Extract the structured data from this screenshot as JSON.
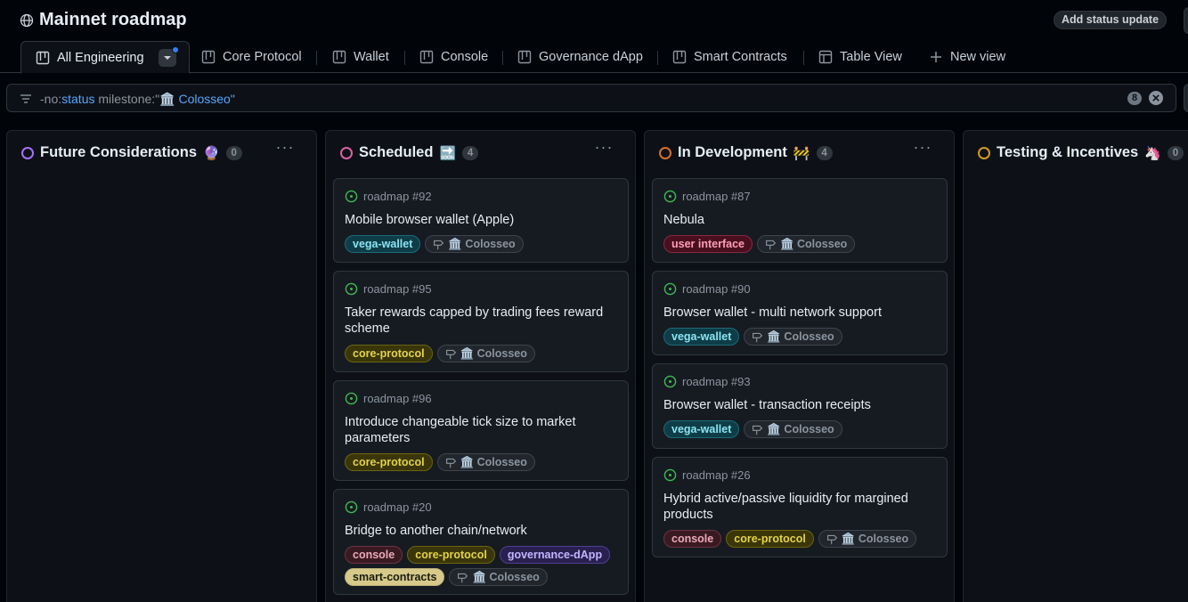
{
  "project": {
    "title": "Mainnet roadmap",
    "status_button": "Add status update"
  },
  "tabs": [
    {
      "label": "All Engineering",
      "icon": "board-icon"
    },
    {
      "label": "Core Protocol",
      "icon": "board-icon"
    },
    {
      "label": "Wallet",
      "icon": "board-icon"
    },
    {
      "label": "Console",
      "icon": "board-icon"
    },
    {
      "label": "Governance dApp",
      "icon": "board-icon"
    },
    {
      "label": "Smart Contracts",
      "icon": "board-icon"
    },
    {
      "label": "Table View",
      "icon": "table-icon"
    },
    {
      "label": "New view",
      "icon": "plus-icon"
    }
  ],
  "filter": {
    "prefix": "-no:",
    "status_kw": "status",
    "milestone_kw": " milestone:\"",
    "milestone_value": "🏛️ Colosseo\"",
    "count": "8"
  },
  "columns": [
    {
      "name": "Future Considerations",
      "emoji": "🔮",
      "count": "0",
      "ring_color": "#a371f7"
    },
    {
      "name": "Scheduled",
      "emoji": "🔜",
      "count": "4",
      "ring_color": "#db61a2"
    },
    {
      "name": "In Development",
      "emoji": "🚧",
      "count": "4",
      "ring_color": "#db6d28"
    },
    {
      "name": "Testing & Incentives",
      "emoji": "🦄",
      "count": "0",
      "ring_color": "#d29922"
    }
  ],
  "milestone_label": "🏛️ Colosseo",
  "cards": {
    "scheduled": [
      {
        "ref": "roadmap #92",
        "title": "Mobile browser wallet (Apple)",
        "labels": [
          "vega-wallet"
        ]
      },
      {
        "ref": "roadmap #95",
        "title": "Taker rewards capped by trading fees reward scheme",
        "labels": [
          "core-protocol"
        ]
      },
      {
        "ref": "roadmap #96",
        "title": "Introduce changeable tick size to market parameters",
        "labels": [
          "core-protocol"
        ]
      },
      {
        "ref": "roadmap #20",
        "title": "Bridge to another chain/network",
        "labels": [
          "console",
          "core-protocol",
          "governance-dApp",
          "smart-contracts"
        ]
      }
    ],
    "in_development": [
      {
        "ref": "roadmap #87",
        "title": "Nebula",
        "labels": [
          "user interface"
        ]
      },
      {
        "ref": "roadmap #90",
        "title": "Browser wallet - multi network support",
        "labels": [
          "vega-wallet"
        ]
      },
      {
        "ref": "roadmap #93",
        "title": "Browser wallet - transaction receipts",
        "labels": [
          "vega-wallet"
        ]
      },
      {
        "ref": "roadmap #26",
        "title": "Hybrid active/passive liquidity for margined products",
        "labels": [
          "console",
          "core-protocol"
        ]
      }
    ]
  },
  "colors": {
    "open_issue": "#3fb950",
    "accent": "#2f81f7"
  }
}
